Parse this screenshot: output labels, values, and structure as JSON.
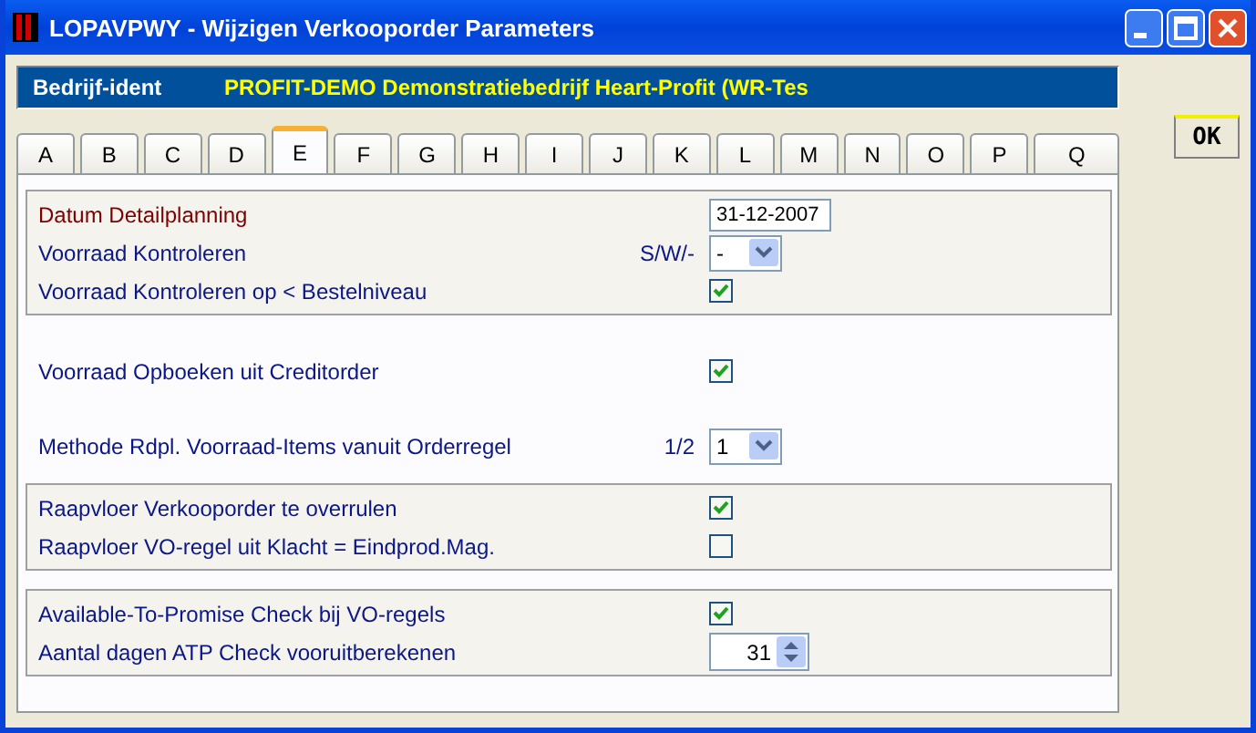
{
  "window": {
    "title": "LOPAVPWY - Wijzigen Verkooporder Parameters"
  },
  "company": {
    "label": "Bedrijf-ident",
    "value": "PROFIT-DEMO Demonstratiebedrijf Heart-Profit (WR-Tes"
  },
  "tabs": [
    {
      "label": "A",
      "selected": false
    },
    {
      "label": "B",
      "selected": false
    },
    {
      "label": "C",
      "selected": false
    },
    {
      "label": "D",
      "selected": false
    },
    {
      "label": "E",
      "selected": true
    },
    {
      "label": "F",
      "selected": false
    },
    {
      "label": "G",
      "selected": false
    },
    {
      "label": "H",
      "selected": false
    },
    {
      "label": "I",
      "selected": false
    },
    {
      "label": "J",
      "selected": false
    },
    {
      "label": "K",
      "selected": false
    },
    {
      "label": "L",
      "selected": false
    },
    {
      "label": "M",
      "selected": false
    },
    {
      "label": "N",
      "selected": false
    },
    {
      "label": "O",
      "selected": false
    },
    {
      "label": "P",
      "selected": false
    },
    {
      "label": "Q",
      "selected": false
    }
  ],
  "ok_button": "OK",
  "sections": [
    {
      "framed": true,
      "rows": [
        {
          "kind": "date",
          "label": "Datum Detailplanning",
          "highlighted": true,
          "value": "31-12-2007"
        },
        {
          "kind": "select",
          "label": "Voorraad Kontroleren",
          "highlighted": false,
          "hint": "S/W/-",
          "value": "-"
        },
        {
          "kind": "checkbox",
          "label": "Voorraad Kontroleren op < Bestelniveau",
          "highlighted": false,
          "checked": true
        }
      ]
    },
    {
      "framed": false,
      "rows": [
        {
          "kind": "checkbox",
          "label": "Voorraad Opboeken uit Creditorder",
          "highlighted": false,
          "checked": true
        }
      ]
    },
    {
      "framed": false,
      "rows": [
        {
          "kind": "select",
          "label": "Methode Rdpl. Voorraad-Items vanuit Orderregel",
          "highlighted": false,
          "hint": "1/2",
          "value": "1"
        }
      ]
    },
    {
      "framed": true,
      "rows": [
        {
          "kind": "checkbox",
          "label": "Raapvloer Verkooporder te overrulen",
          "highlighted": false,
          "checked": true
        },
        {
          "kind": "checkbox",
          "label": "Raapvloer VO-regel uit Klacht = Eindprod.Mag.",
          "highlighted": false,
          "checked": false
        }
      ]
    },
    {
      "framed": true,
      "rows": [
        {
          "kind": "checkbox",
          "label": "Available-To-Promise Check bij VO-regels",
          "highlighted": false,
          "checked": true
        },
        {
          "kind": "spinner",
          "label": "Aantal dagen ATP Check vooruitberekenen",
          "highlighted": false,
          "value": "31"
        }
      ]
    }
  ]
}
